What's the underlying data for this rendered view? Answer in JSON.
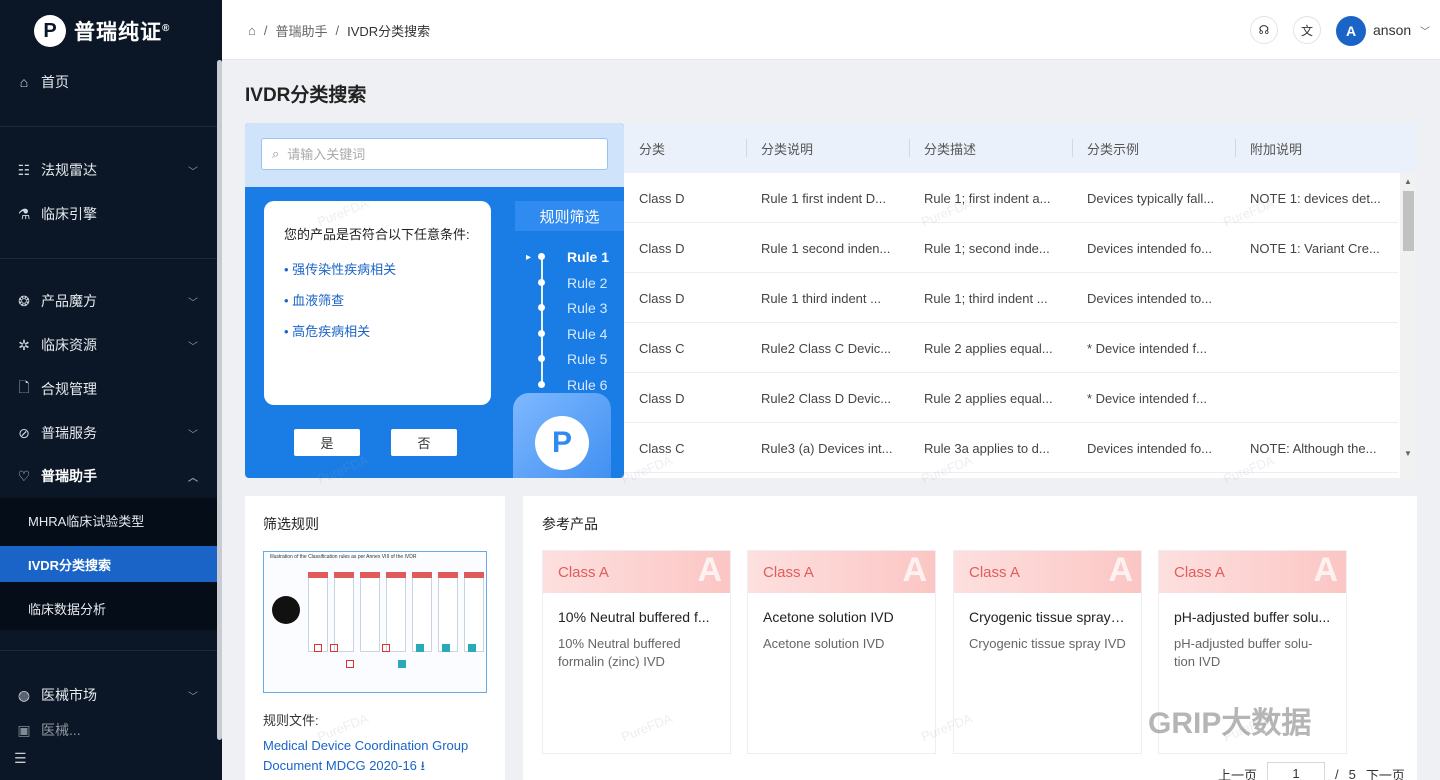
{
  "app": {
    "logo_mark": "P",
    "logo_name": "普瑞纯证",
    "logo_reg": "®"
  },
  "sidebar": {
    "items": [
      {
        "label": "首页",
        "icon": "home-icon"
      },
      {
        "label": "法规雷达",
        "icon": "radar-icon"
      },
      {
        "label": "临床引擎",
        "icon": "flask-icon"
      },
      {
        "label": "产品魔方",
        "icon": "cube-icon"
      },
      {
        "label": "临床资源",
        "icon": "gear-icon"
      },
      {
        "label": "合规管理",
        "icon": "doc-icon"
      },
      {
        "label": "普瑞服务",
        "icon": "service-icon"
      },
      {
        "label": "普瑞助手",
        "icon": "heart-icon"
      },
      {
        "label": "医械市场",
        "icon": "globe-icon"
      },
      {
        "label": "医械..."
      }
    ],
    "sub_items": [
      {
        "label": "MHRA临床试验类型"
      },
      {
        "label": "IVDR分类搜索"
      },
      {
        "label": "临床数据分析"
      }
    ]
  },
  "header": {
    "breadcrumb": [
      "普瑞助手",
      "IVDR分类搜索"
    ],
    "user_initial": "A",
    "username": "anson"
  },
  "page": {
    "title": "IVDR分类搜索"
  },
  "filter": {
    "search_placeholder": "请输入关键词",
    "question": "您的产品是否符合以下任意条件:",
    "conditions": [
      "强传染性疾病相关",
      "血液筛查",
      "高危疾病相关"
    ],
    "yes": "是",
    "no": "否",
    "tab": "规则筛选",
    "rules": [
      "Rule 1",
      "Rule 2",
      "Rule 3",
      "Rule 4",
      "Rule 5",
      "Rule 6"
    ]
  },
  "table": {
    "headers": [
      "分类",
      "分类说明",
      "分类描述",
      "分类示例",
      "附加说明"
    ],
    "rows": [
      [
        "Class D",
        "Rule 1 first indent D...",
        "Rule 1; first indent a...",
        "Devices typically fall...",
        "NOTE 1: devices det..."
      ],
      [
        "Class D",
        "Rule 1 second inden...",
        "Rule 1; second inde...",
        "Devices intended fo...",
        "NOTE 1: Variant Cre..."
      ],
      [
        "Class D",
        "Rule 1 third indent ...",
        "Rule 1; third indent ...",
        "Devices intended to...",
        ""
      ],
      [
        "Class C",
        "Rule2 Class C Devic...",
        "Rule 2 applies equal...",
        "* Device intended f...",
        ""
      ],
      [
        "Class D",
        "Rule2 Class D Devic...",
        "Rule 2 applies equal...",
        "* Device intended f...",
        ""
      ],
      [
        "Class C",
        "Rule3 (a) Devices int...",
        "Rule 3a applies to d...",
        "Devices intended fo...",
        "NOTE: Although the..."
      ]
    ]
  },
  "rules_panel": {
    "title": "筛选规则",
    "image_caption": "Illustration of the Classification rules as per Annex VIII of the IVDR",
    "file_label": "规则文件:",
    "file_link": "Medical Device Coordination Group Document MDCG 2020-16"
  },
  "reference": {
    "title": "参考产品",
    "cards": [
      {
        "class": "Class A",
        "name": "10% Neutral buffered f...",
        "desc": "10% Neutral buffered formalin (zinc) IVD"
      },
      {
        "class": "Class A",
        "name": "Acetone solution IVD",
        "desc": "Acetone solution IVD"
      },
      {
        "class": "Class A",
        "name": "Cryogenic tissue spray I...",
        "desc": "Cryogenic tissue spray IVD"
      },
      {
        "class": "Class A",
        "name": "pH-adjusted buffer solu...",
        "desc": "pH-adjusted buffer solu-tion IVD"
      }
    ],
    "card_watermark": "A"
  },
  "pager": {
    "prev": "上一页",
    "page": "1",
    "sep": "/",
    "total": "5",
    "next": "下一页"
  },
  "watermark": {
    "text": "PureFDA",
    "channel": "GRIP大数据"
  },
  "colors": {
    "sidebar": "#0b1726",
    "accent": "#1a64c8",
    "panel_blue": "#1a7de6",
    "class_tag": "#e25c5a"
  }
}
